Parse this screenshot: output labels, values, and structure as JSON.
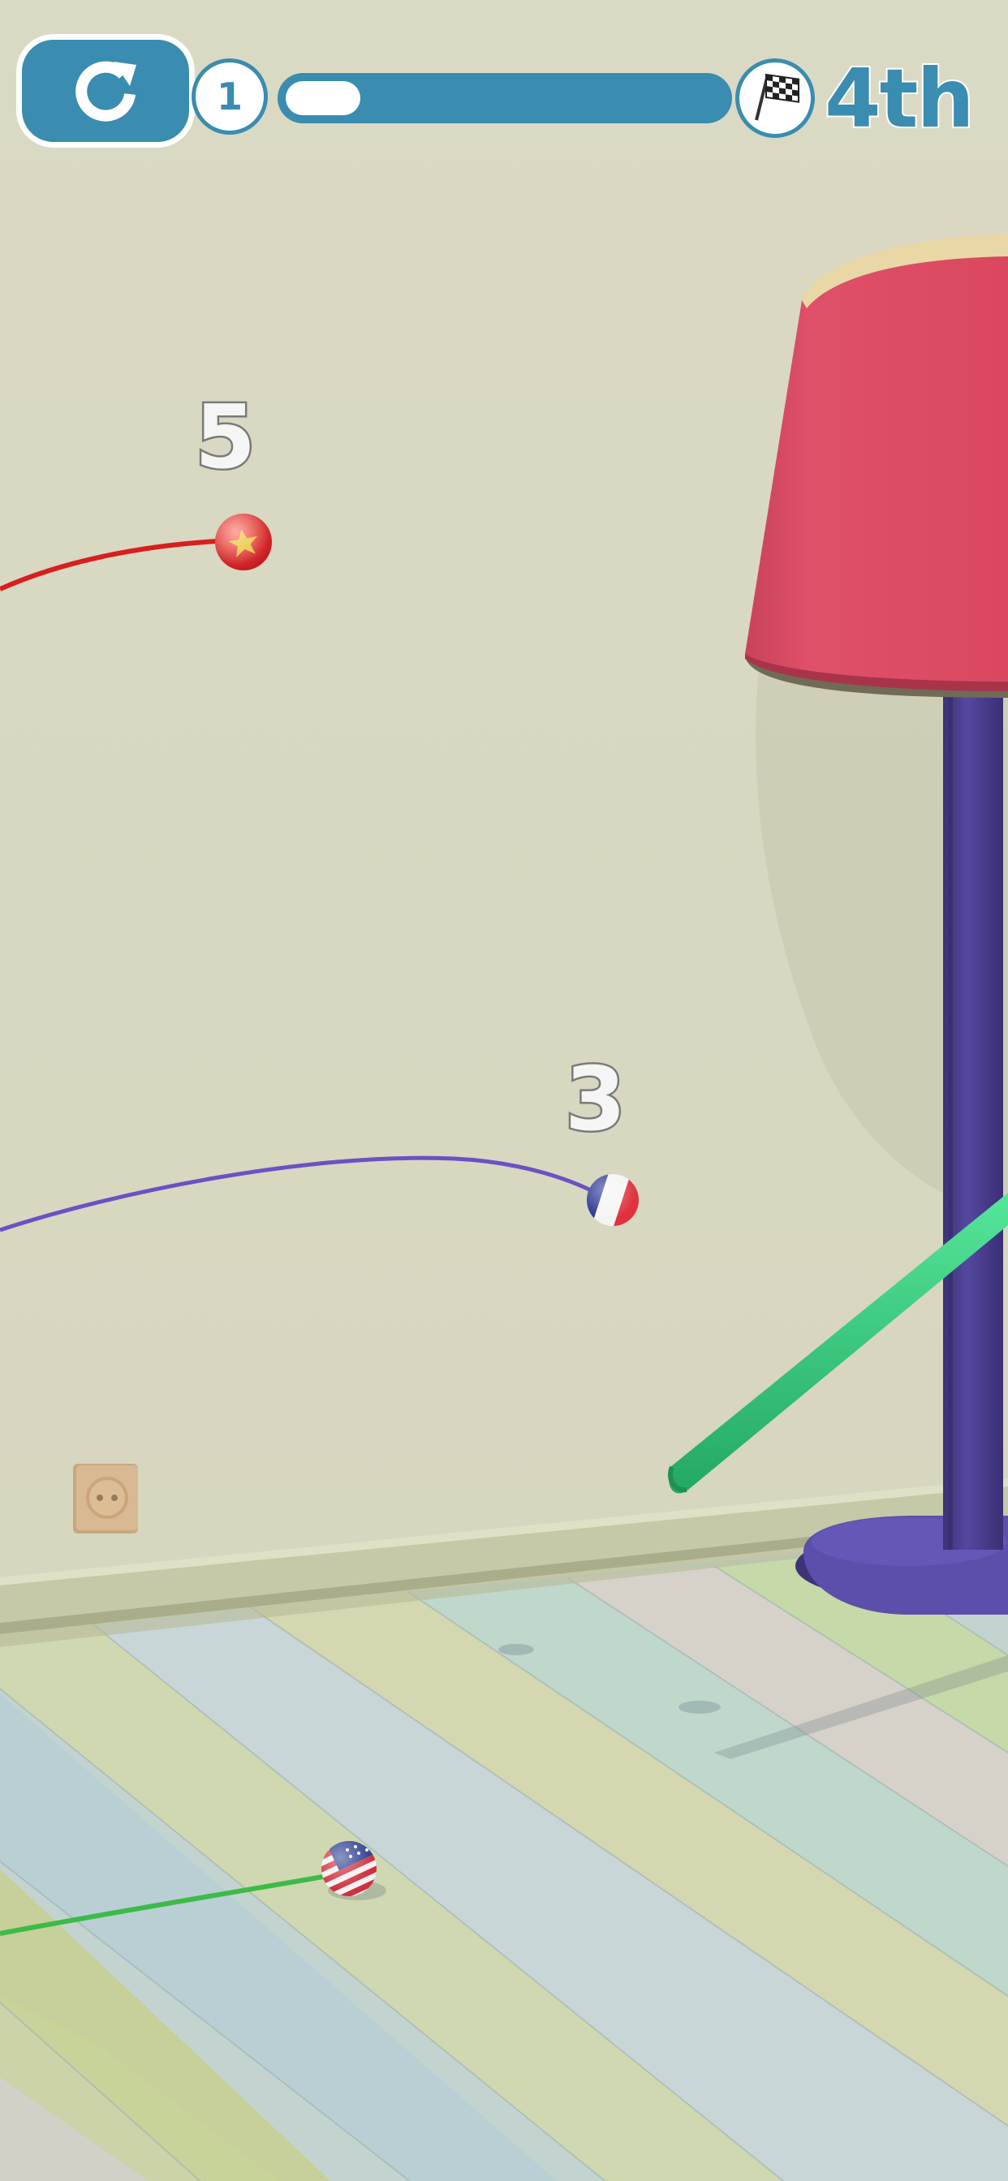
{
  "hud": {
    "restart_icon": "restart-icon",
    "level": "1",
    "progress": 0.17,
    "finish_icon": "checkered-flag-icon",
    "position": "4th"
  },
  "racers": [
    {
      "rank": "5",
      "ball": "vietnam-flag-ball",
      "trail_color": "#d81e1e"
    },
    {
      "rank": "3",
      "ball": "france-flag-ball",
      "trail_color": "#6a52c4"
    },
    {
      "rank": "",
      "ball": "usa-flag-ball",
      "trail_color": "#3dba48"
    }
  ],
  "colors": {
    "hud_blue": "#3a8cb0",
    "wall": "#d9d8c3",
    "lamp_shade": "#dd4e67",
    "lamp_pole": "#4a3f8c",
    "green_stick": "#2fc777"
  }
}
